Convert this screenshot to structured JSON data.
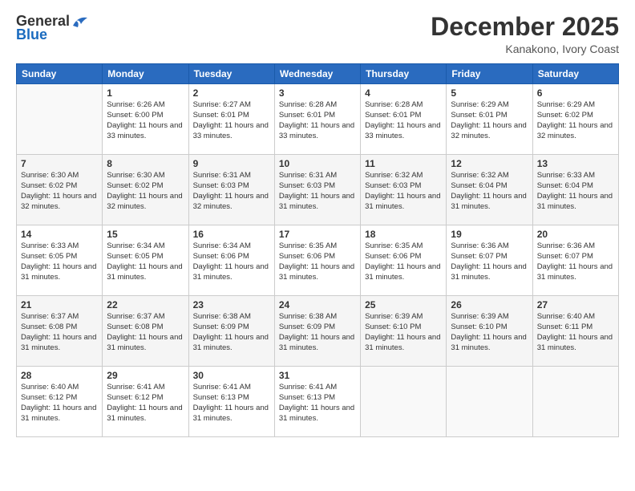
{
  "logo": {
    "general": "General",
    "blue": "Blue"
  },
  "header": {
    "month": "December 2025",
    "location": "Kanakono, Ivory Coast"
  },
  "weekdays": [
    "Sunday",
    "Monday",
    "Tuesday",
    "Wednesday",
    "Thursday",
    "Friday",
    "Saturday"
  ],
  "weeks": [
    [
      {
        "day": "",
        "empty": true
      },
      {
        "day": "1",
        "sunrise": "6:26 AM",
        "sunset": "6:00 PM",
        "daylight": "11 hours and 33 minutes."
      },
      {
        "day": "2",
        "sunrise": "6:27 AM",
        "sunset": "6:01 PM",
        "daylight": "11 hours and 33 minutes."
      },
      {
        "day": "3",
        "sunrise": "6:28 AM",
        "sunset": "6:01 PM",
        "daylight": "11 hours and 33 minutes."
      },
      {
        "day": "4",
        "sunrise": "6:28 AM",
        "sunset": "6:01 PM",
        "daylight": "11 hours and 33 minutes."
      },
      {
        "day": "5",
        "sunrise": "6:29 AM",
        "sunset": "6:01 PM",
        "daylight": "11 hours and 32 minutes."
      },
      {
        "day": "6",
        "sunrise": "6:29 AM",
        "sunset": "6:02 PM",
        "daylight": "11 hours and 32 minutes."
      }
    ],
    [
      {
        "day": "7",
        "sunrise": "6:30 AM",
        "sunset": "6:02 PM",
        "daylight": "11 hours and 32 minutes."
      },
      {
        "day": "8",
        "sunrise": "6:30 AM",
        "sunset": "6:02 PM",
        "daylight": "11 hours and 32 minutes."
      },
      {
        "day": "9",
        "sunrise": "6:31 AM",
        "sunset": "6:03 PM",
        "daylight": "11 hours and 32 minutes."
      },
      {
        "day": "10",
        "sunrise": "6:31 AM",
        "sunset": "6:03 PM",
        "daylight": "11 hours and 31 minutes."
      },
      {
        "day": "11",
        "sunrise": "6:32 AM",
        "sunset": "6:03 PM",
        "daylight": "11 hours and 31 minutes."
      },
      {
        "day": "12",
        "sunrise": "6:32 AM",
        "sunset": "6:04 PM",
        "daylight": "11 hours and 31 minutes."
      },
      {
        "day": "13",
        "sunrise": "6:33 AM",
        "sunset": "6:04 PM",
        "daylight": "11 hours and 31 minutes."
      }
    ],
    [
      {
        "day": "14",
        "sunrise": "6:33 AM",
        "sunset": "6:05 PM",
        "daylight": "11 hours and 31 minutes."
      },
      {
        "day": "15",
        "sunrise": "6:34 AM",
        "sunset": "6:05 PM",
        "daylight": "11 hours and 31 minutes."
      },
      {
        "day": "16",
        "sunrise": "6:34 AM",
        "sunset": "6:06 PM",
        "daylight": "11 hours and 31 minutes."
      },
      {
        "day": "17",
        "sunrise": "6:35 AM",
        "sunset": "6:06 PM",
        "daylight": "11 hours and 31 minutes."
      },
      {
        "day": "18",
        "sunrise": "6:35 AM",
        "sunset": "6:06 PM",
        "daylight": "11 hours and 31 minutes."
      },
      {
        "day": "19",
        "sunrise": "6:36 AM",
        "sunset": "6:07 PM",
        "daylight": "11 hours and 31 minutes."
      },
      {
        "day": "20",
        "sunrise": "6:36 AM",
        "sunset": "6:07 PM",
        "daylight": "11 hours and 31 minutes."
      }
    ],
    [
      {
        "day": "21",
        "sunrise": "6:37 AM",
        "sunset": "6:08 PM",
        "daylight": "11 hours and 31 minutes."
      },
      {
        "day": "22",
        "sunrise": "6:37 AM",
        "sunset": "6:08 PM",
        "daylight": "11 hours and 31 minutes."
      },
      {
        "day": "23",
        "sunrise": "6:38 AM",
        "sunset": "6:09 PM",
        "daylight": "11 hours and 31 minutes."
      },
      {
        "day": "24",
        "sunrise": "6:38 AM",
        "sunset": "6:09 PM",
        "daylight": "11 hours and 31 minutes."
      },
      {
        "day": "25",
        "sunrise": "6:39 AM",
        "sunset": "6:10 PM",
        "daylight": "11 hours and 31 minutes."
      },
      {
        "day": "26",
        "sunrise": "6:39 AM",
        "sunset": "6:10 PM",
        "daylight": "11 hours and 31 minutes."
      },
      {
        "day": "27",
        "sunrise": "6:40 AM",
        "sunset": "6:11 PM",
        "daylight": "11 hours and 31 minutes."
      }
    ],
    [
      {
        "day": "28",
        "sunrise": "6:40 AM",
        "sunset": "6:12 PM",
        "daylight": "11 hours and 31 minutes."
      },
      {
        "day": "29",
        "sunrise": "6:41 AM",
        "sunset": "6:12 PM",
        "daylight": "11 hours and 31 minutes."
      },
      {
        "day": "30",
        "sunrise": "6:41 AM",
        "sunset": "6:13 PM",
        "daylight": "11 hours and 31 minutes."
      },
      {
        "day": "31",
        "sunrise": "6:41 AM",
        "sunset": "6:13 PM",
        "daylight": "11 hours and 31 minutes."
      },
      {
        "day": "",
        "empty": true
      },
      {
        "day": "",
        "empty": true
      },
      {
        "day": "",
        "empty": true
      }
    ]
  ],
  "labels": {
    "sunrise": "Sunrise: ",
    "sunset": "Sunset: ",
    "daylight": "Daylight: "
  }
}
